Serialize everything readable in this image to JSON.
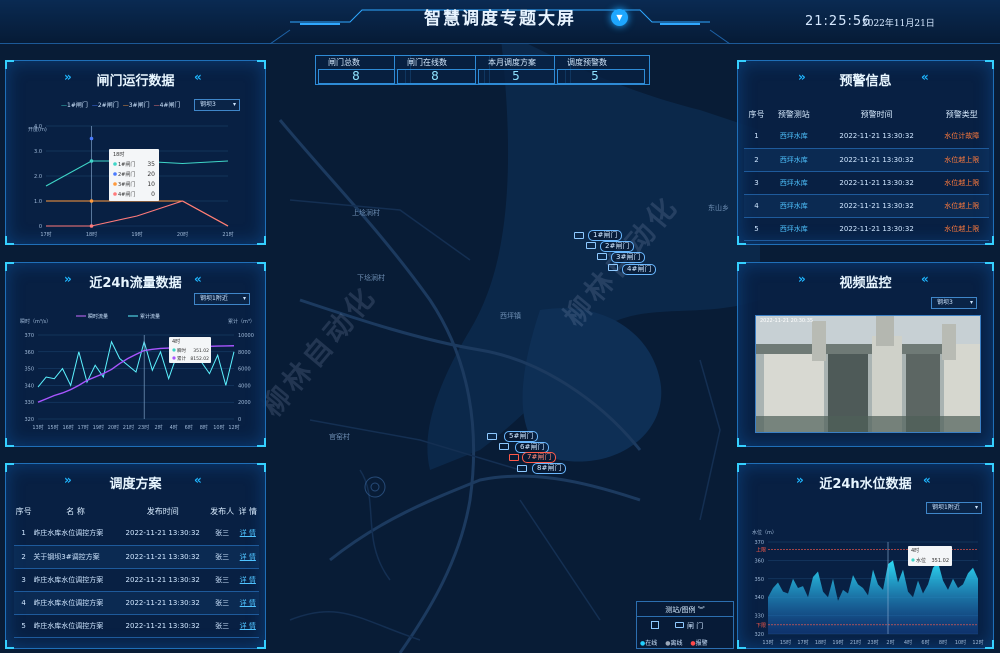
{
  "header": {
    "title": "智慧调度专题大屏",
    "clock": "21:25:56",
    "date": "2022年11月21日"
  },
  "stats": [
    {
      "label": "闸门总数",
      "value": "8"
    },
    {
      "label": "闸门在线数",
      "value": "8"
    },
    {
      "label": "本月调度方案",
      "value": "5"
    },
    {
      "label": "调度预警数",
      "value": "5"
    }
  ],
  "gate_panel": {
    "title": "闸门运行数据",
    "legend": [
      "1#闸门",
      "2#闸门",
      "3#闸门",
      "4#闸门"
    ],
    "select": "钢坝3",
    "ylabel": "开度(m)",
    "tooltip": {
      "time": "18时",
      "rows": [
        {
          "name": "1#闸门",
          "value": "35"
        },
        {
          "name": "2#闸门",
          "value": "20"
        },
        {
          "name": "3#闸门",
          "value": "10"
        },
        {
          "name": "4#闸门",
          "value": "0"
        }
      ]
    },
    "colors": [
      "#3fd6c8",
      "#4a7bff",
      "#ff9a3c",
      "#ff7a7a"
    ]
  },
  "flow_panel": {
    "title": "近24h流量数据",
    "select": "钢坝1附近",
    "legend": [
      "瞬时流量",
      "累计流量"
    ],
    "left_label": "瞬时（m³/s）",
    "right_label": "累计（m³）",
    "tooltip": {
      "time": "4时",
      "rows": [
        {
          "name": "瞬时",
          "value": "351.02"
        },
        {
          "name": "累计",
          "value": "8152.02"
        }
      ]
    }
  },
  "plan_panel": {
    "title": "调度方案",
    "columns": [
      "序号",
      "名 称",
      "发布时间",
      "发布人",
      "详 情"
    ],
    "rows": [
      {
        "no": "1",
        "name": "岞庄水库水位调控方案",
        "time": "2022-11-21 13:30:32",
        "person": "张三",
        "detail": "详 情"
      },
      {
        "no": "2",
        "name": "关于钢坝3#调控方案",
        "time": "2022-11-21 13:30:32",
        "person": "张三",
        "detail": "详 情"
      },
      {
        "no": "3",
        "name": "岞庄水库水位调控方案",
        "time": "2022-11-21 13:30:32",
        "person": "张三",
        "detail": "详 情"
      },
      {
        "no": "4",
        "name": "岞庄水库水位调控方案",
        "time": "2022-11-21 13:30:32",
        "person": "张三",
        "detail": "详 情"
      },
      {
        "no": "5",
        "name": "岞庄水库水位调控方案",
        "time": "2022-11-21 13:30:32",
        "person": "张三",
        "detail": "详 情"
      }
    ]
  },
  "warn_panel": {
    "title": "预警信息",
    "columns": [
      "序号",
      "预警测站",
      "预警时间",
      "预警类型"
    ],
    "rows": [
      {
        "no": "1",
        "station": "西坪水库",
        "time": "2022-11-21 13:30:32",
        "type": "水位计故障"
      },
      {
        "no": "2",
        "station": "西坪水库",
        "time": "2022-11-21 13:30:32",
        "type": "水位越上限"
      },
      {
        "no": "3",
        "station": "西坪水库",
        "time": "2022-11-21 13:30:32",
        "type": "水位越上限"
      },
      {
        "no": "4",
        "station": "西坪水库",
        "time": "2022-11-21 13:30:32",
        "type": "水位越上限"
      },
      {
        "no": "5",
        "station": "西坪水库",
        "time": "2022-11-21 13:30:32",
        "type": "水位越上限"
      }
    ]
  },
  "video_panel": {
    "title": "视频监控",
    "select": "钢坝3",
    "timestamp": "2022-11-21 20:30:35"
  },
  "level_panel": {
    "title": "近24h水位数据",
    "select": "钢坝1附近",
    "ylabel": "水位（m）",
    "upper": "上限",
    "lower": "下限",
    "tooltip": {
      "time": "4时",
      "name": "水位",
      "value": "351.02"
    }
  },
  "map": {
    "places": [
      "上埝涧村",
      "下埝涧村",
      "西坪镇",
      "官窑村",
      "东山乡"
    ],
    "gates": [
      "1#闸门",
      "2#闸门",
      "3#闸门",
      "4#闸门",
      "5#闸门",
      "6#闸门",
      "7#闸门",
      "8#闸门"
    ],
    "legend_title": "测站/图例",
    "legend_item": "闸 门",
    "status": [
      "在线",
      "离线",
      "报警"
    ],
    "status_colors": [
      "#23d0ff",
      "#9aa7b8",
      "#ff4a4a"
    ],
    "watermark": "柳林自动化"
  },
  "chart_data": [
    {
      "type": "line",
      "title": "闸门运行数据",
      "ylabel": "开度(m)",
      "categories": [
        "17时",
        "18时",
        "19时",
        "20时",
        "21时"
      ],
      "ylim": [
        0,
        4
      ],
      "yticks": [
        "0",
        "1.0",
        "2.0",
        "3.0",
        "4.0"
      ],
      "series": [
        {
          "name": "1#闸门",
          "values": [
            1.6,
            2.6,
            2.6,
            2.5,
            2.6
          ]
        },
        {
          "name": "2#闸门",
          "values": [
            null,
            3.5,
            null,
            null,
            null
          ]
        },
        {
          "name": "3#闸门",
          "values": [
            1.0,
            1.0,
            1.0,
            1.0,
            0.0
          ]
        },
        {
          "name": "4#闸门",
          "values": [
            0.0,
            0.0,
            0.4,
            1.0,
            0.0
          ]
        }
      ]
    },
    {
      "type": "line",
      "title": "近24h流量数据",
      "categories": [
        "13时",
        "15时",
        "16时",
        "17时",
        "19时",
        "20时",
        "21时",
        "23时",
        "2时",
        "4时",
        "6时",
        "8时",
        "10时",
        "12时"
      ],
      "ylim": [
        320,
        370
      ],
      "yticks": [
        "320",
        "330",
        "340",
        "350",
        "360",
        "370"
      ],
      "y2lim": [
        0,
        10000
      ],
      "y2ticks": [
        "0",
        "2000",
        "4000",
        "6000",
        "8000",
        "10000"
      ],
      "series": [
        {
          "name": "瞬时流量",
          "values": [
            339,
            345,
            344,
            350,
            340,
            360,
            342,
            352,
            345,
            366,
            356,
            352,
            348,
            366,
            349,
            360,
            344,
            358,
            355,
            368,
            354,
            347,
            358,
            340,
            360
          ]
        },
        {
          "name": "累计流量",
          "values": [
            2000,
            2400,
            2800,
            3100,
            3500,
            4000,
            4600,
            5000,
            5400,
            5900,
            6600,
            7200,
            7700,
            8152,
            8300,
            8400,
            8450,
            8500,
            8550,
            8600,
            8620,
            8650,
            8680,
            8700,
            8720
          ]
        }
      ]
    },
    {
      "type": "area",
      "title": "近24h水位数据",
      "ylabel": "水位（m）",
      "categories": [
        "13时",
        "15时",
        "17时",
        "18时",
        "19时",
        "21时",
        "23时",
        "2时",
        "4时",
        "6时",
        "8时",
        "10时",
        "12时"
      ],
      "ylim": [
        320,
        370
      ],
      "yticks": [
        "320",
        "330",
        "340",
        "350",
        "360",
        "370"
      ],
      "series": [
        {
          "name": "水位",
          "values": [
            340,
            345,
            348,
            343,
            342,
            350,
            345,
            346,
            340,
            351,
            354,
            343,
            340,
            350,
            338,
            344,
            342,
            352,
            347,
            345,
            341,
            355,
            347,
            344,
            358,
            360,
            348,
            355,
            343,
            340,
            349,
            342,
            347,
            356,
            359,
            349,
            344,
            350,
            345,
            347,
            353,
            356,
            350
          ]
        }
      ]
    }
  ]
}
